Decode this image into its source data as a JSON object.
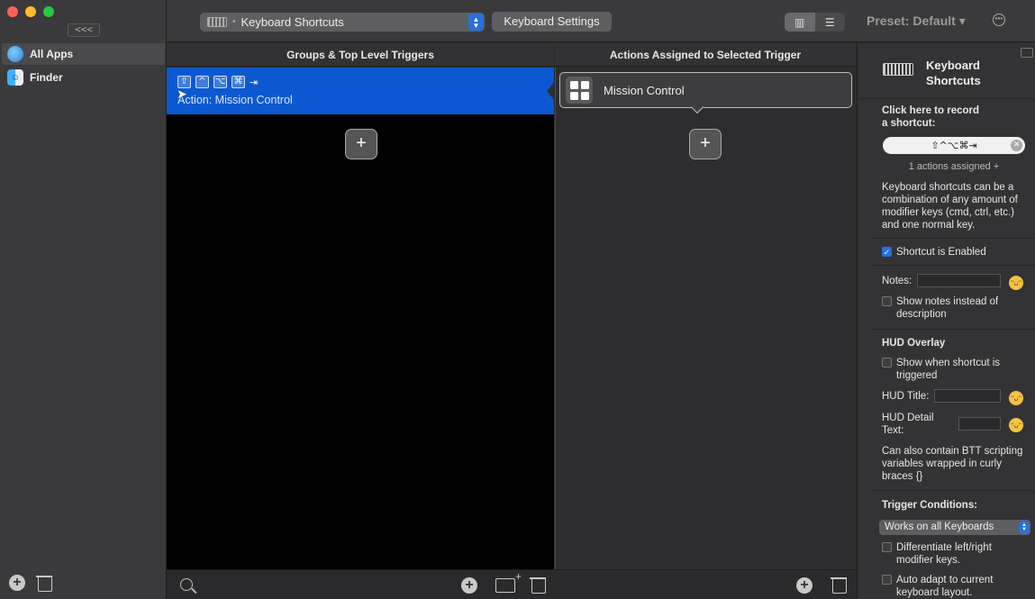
{
  "sidebar": {
    "collapse_label": "<<<",
    "apps": [
      {
        "label": "All Apps",
        "icon": "globe-icon",
        "selected": true
      },
      {
        "label": "Finder",
        "icon": "finder-icon",
        "selected": false
      }
    ]
  },
  "toolbar": {
    "trigger_type_select": "Keyboard Shortcuts",
    "keyboard_settings_label": "Keyboard Settings",
    "preset_label": "Preset: Default ▾",
    "more_icon": "ellipsis-circle-icon"
  },
  "columns": {
    "triggers_header": "Groups & Top Level Triggers",
    "actions_header": "Actions Assigned to Selected Trigger"
  },
  "trigger": {
    "keys": [
      "⇧",
      "^",
      "⌥",
      "⌘",
      "⇥"
    ],
    "description": "Action: Mission Control"
  },
  "action": {
    "label": "Mission Control",
    "icon": "mission-control-icon"
  },
  "inspector": {
    "title_line1": "Keyboard",
    "title_line2": "Shortcuts",
    "record_prompt_line1": "Click here to record",
    "record_prompt_line2": "a shortcut:",
    "recorded_shortcut": "⇧^⌥⌘⇥",
    "actions_assigned": "1 actions assigned +",
    "help_line1": "Keyboard shortcuts can be a",
    "help_line2": "combination of any amount of",
    "help_line3": "modifier keys (cmd, ctrl, etc.)",
    "help_line4": "and one normal key.",
    "shortcut_enabled_label": "Shortcut is Enabled",
    "shortcut_enabled": true,
    "notes_label": "Notes:",
    "notes_value": "",
    "show_notes_line1": "Show notes instead of",
    "show_notes_line2": "description",
    "hud_section": "HUD Overlay",
    "hud_show_line1": "Show when shortcut is",
    "hud_show_line2": "triggered",
    "hud_title_label": "HUD Title:",
    "hud_title_value": "",
    "hud_detail_line1": "HUD Detail",
    "hud_detail_line2": "Text:",
    "hud_detail_value": "",
    "scripting_line1": "Can also contain BTT scripting",
    "scripting_line2": "variables wrapped in curly",
    "scripting_line3": "braces {}",
    "conditions_section": "Trigger Conditions:",
    "conditions_select": "Works on all Keyboards",
    "differentiate_line1": "Differentiate left/right",
    "differentiate_line2": "modifier keys.",
    "auto_adapt_line1": "Auto adapt to current",
    "auto_adapt_line2": "keyboard layout."
  }
}
